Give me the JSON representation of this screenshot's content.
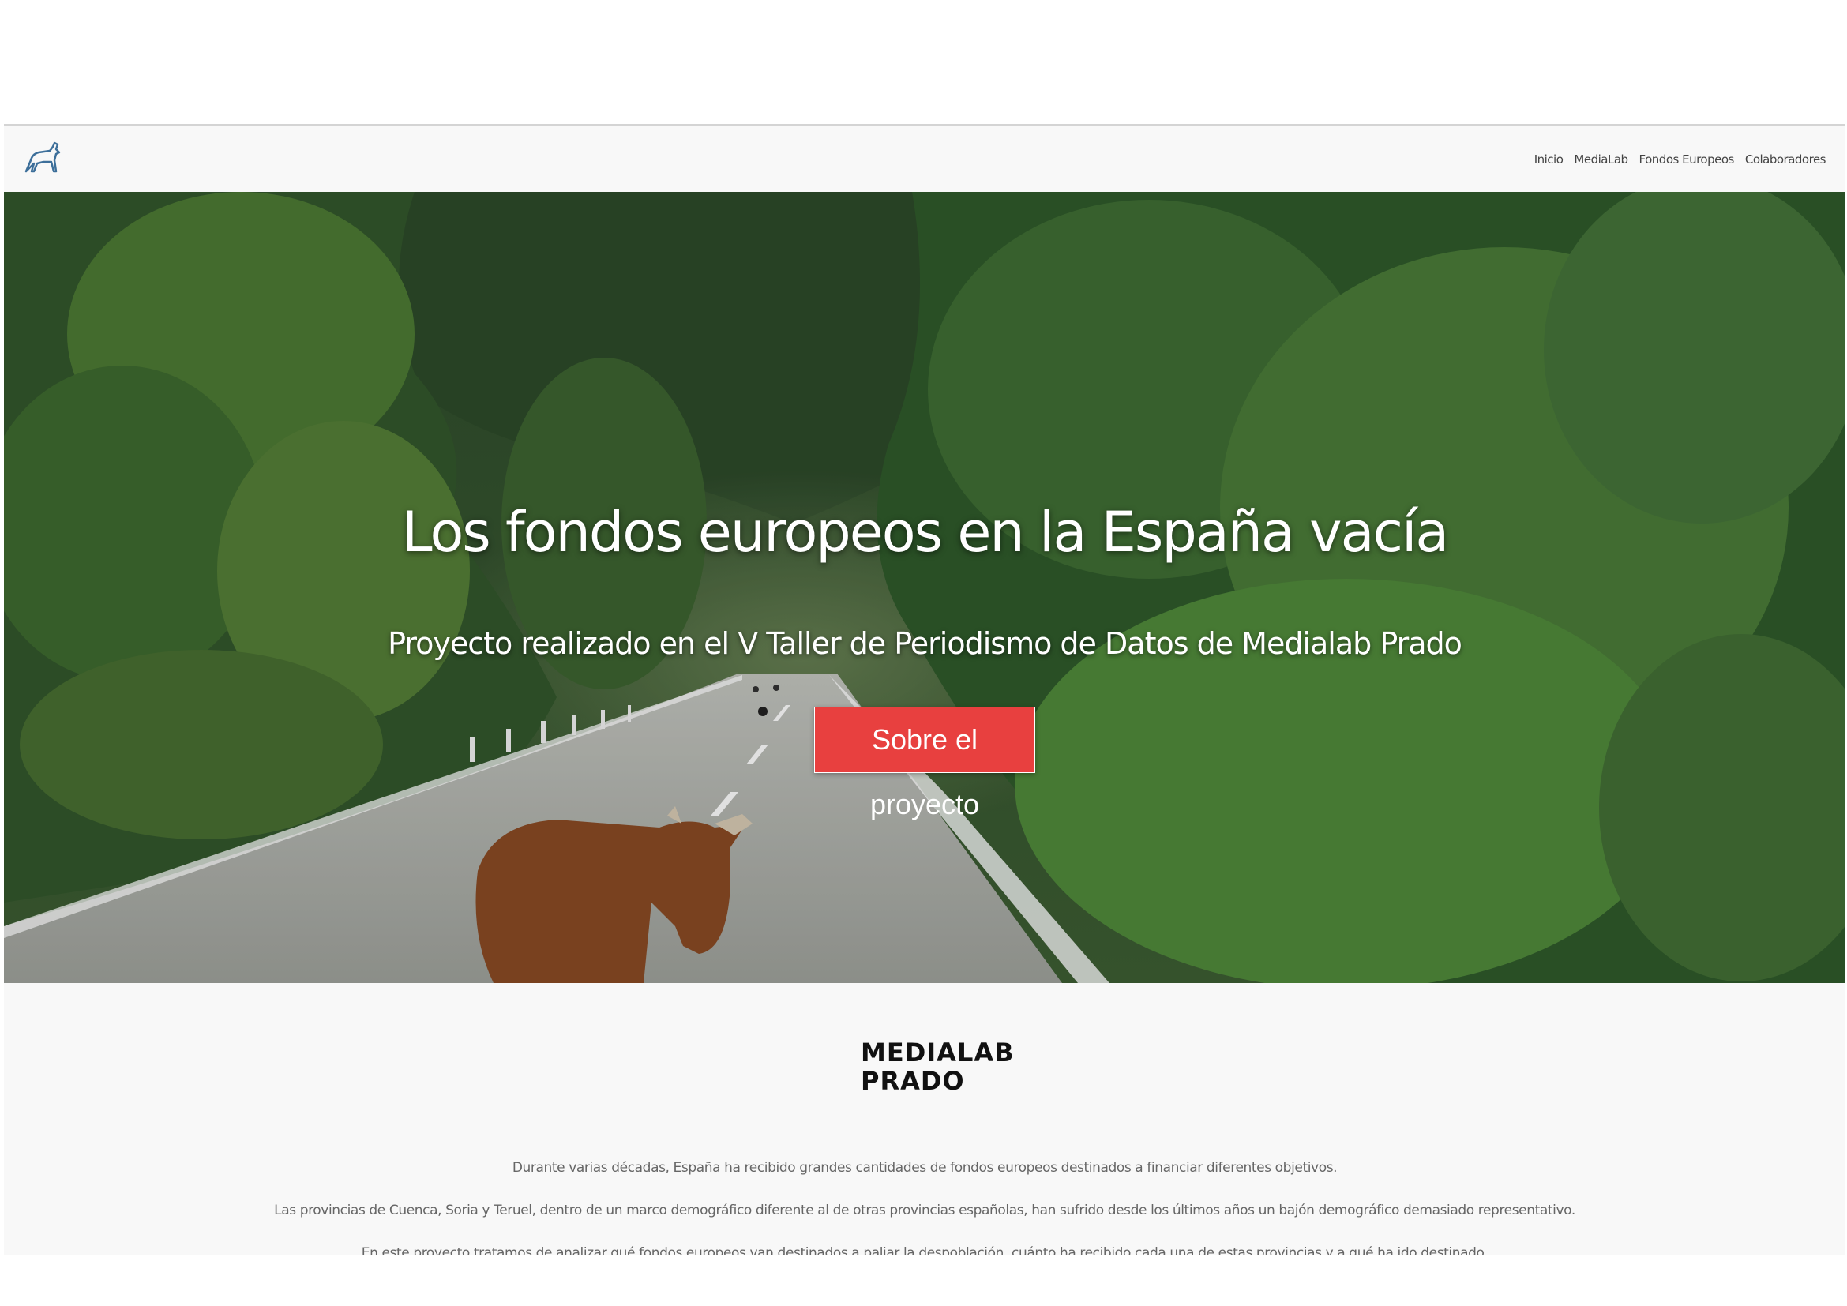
{
  "nav": {
    "items": [
      {
        "label": "Inicio"
      },
      {
        "label": "MediaLab"
      },
      {
        "label": "Fondos Europeos"
      },
      {
        "label": "Colaboradores"
      }
    ]
  },
  "hero": {
    "title": "Los fondos europeos en la España vacía",
    "subtitle": "Proyecto realizado en el V Taller de Periodismo de Datos de Medialab Prado",
    "button_label": "Sobre el proyecto"
  },
  "partner": {
    "line1": "MEDIALAB",
    "line2": "PRADO"
  },
  "intro": {
    "paragraphs": [
      "Durante varias décadas, España ha recibido grandes cantidades de fondos europeos destinados a financiar diferentes objetivos.",
      "Las provincias de Cuenca, Soria y Teruel, dentro de un marco demográfico diferente al de otras provincias españolas, han sufrido desde los últimos años un bajón demográfico demasiado representativo.",
      "En este proyecto tratamos de analizar qué fondos europeos van destinados a paliar la despoblación, cuánto ha recibido cada una de estas provincias y a qué ha ido destinado."
    ]
  },
  "colors": {
    "accent": "#e8403f",
    "navbar_bg": "#f8f8f8",
    "forest": "#3f6b35",
    "road": "#a9aca6"
  }
}
